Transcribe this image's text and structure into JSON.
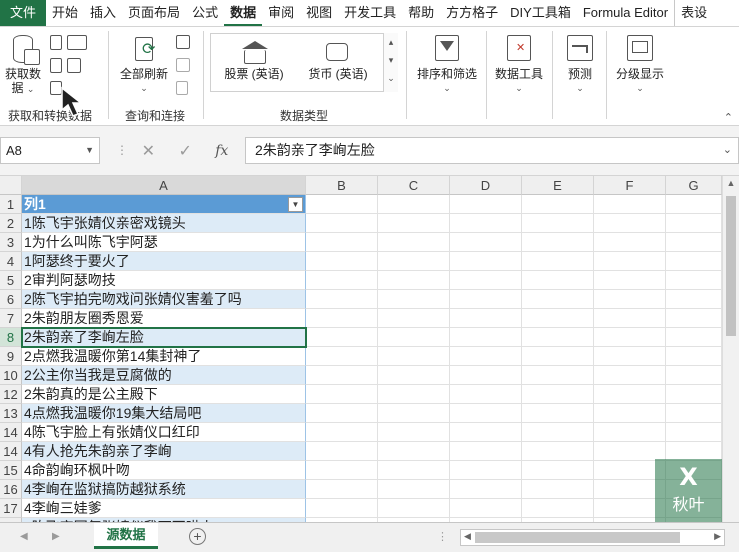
{
  "menu": {
    "tabs": [
      "文件",
      "开始",
      "插入",
      "页面布局",
      "公式",
      "数据",
      "审阅",
      "视图",
      "开发工具",
      "帮助",
      "方方格子",
      "DIY工具箱",
      "Formula Editor",
      "表设"
    ],
    "active": "数据"
  },
  "ribbon": {
    "get_data_label": "获取数\n据",
    "get_data_line1": "获取数",
    "get_data_line2": "据",
    "group_get_transform": "获取和转换数据",
    "refresh_all": "全部刷新",
    "group_queries": "查询和连接",
    "stocks": "股票 (英语)",
    "currencies": "货币 (英语)",
    "group_datatypes": "数据类型",
    "sort_filter": "排序和筛选",
    "data_tools": "数据工具",
    "forecast": "预测",
    "outline": "分级显示"
  },
  "formula_bar": {
    "name_box": "A8",
    "cancel_icon": "✕",
    "enter_icon": "✓",
    "fx_label": "fx",
    "formula": "2朱韵亲了李峋左脸"
  },
  "grid": {
    "columns": [
      "A",
      "B",
      "C",
      "D",
      "E",
      "F",
      "G"
    ],
    "rows": [
      {
        "num": "1",
        "value": "列1"
      },
      {
        "num": "2",
        "value": "1陈飞宇张婧仪亲密戏镜头"
      },
      {
        "num": "3",
        "value": "1为什么叫陈飞宇阿瑟"
      },
      {
        "num": "4",
        "value": "1阿瑟终于要火了"
      },
      {
        "num": "5",
        "value": "2审判阿瑟吻技"
      },
      {
        "num": "6",
        "value": "2陈飞宇拍完吻戏问张婧仪害羞了吗"
      },
      {
        "num": "7",
        "value": "2朱韵朋友圈秀恩爱"
      },
      {
        "num": "8",
        "value": "2朱韵亲了李峋左脸"
      },
      {
        "num": "9",
        "value": "2点燃我温暖你第14集封神了"
      },
      {
        "num": "10",
        "value": "2公主你当我是豆腐做的"
      },
      {
        "num": "12",
        "value": "2朱韵真的是公主殿下"
      },
      {
        "num": "13",
        "value": "4点燃我温暖你19集大结局吧"
      },
      {
        "num": "14",
        "value": "4陈飞宇脸上有张婧仪口红印"
      },
      {
        "num": "14",
        "value": "4有人抢先朱韵亲了李峋"
      },
      {
        "num": "15",
        "value": "4命韵峋环枫叶吻"
      },
      {
        "num": "16",
        "value": "4李峋在监狱搞防越狱系统"
      },
      {
        "num": "17",
        "value": "4李峋三娃爹"
      },
      {
        "num": "18",
        "value": "4陈飞宇回复张婧仪我可不哄人"
      }
    ],
    "active_row_index": 7
  },
  "sheets": {
    "tabs": [
      "源数据"
    ],
    "active": "源数据"
  },
  "watermark": {
    "icon": "X",
    "text": "秋叶"
  },
  "colors": {
    "accent": "#217346",
    "table_header": "#5b9bd5",
    "table_band": "#ddebf7"
  }
}
